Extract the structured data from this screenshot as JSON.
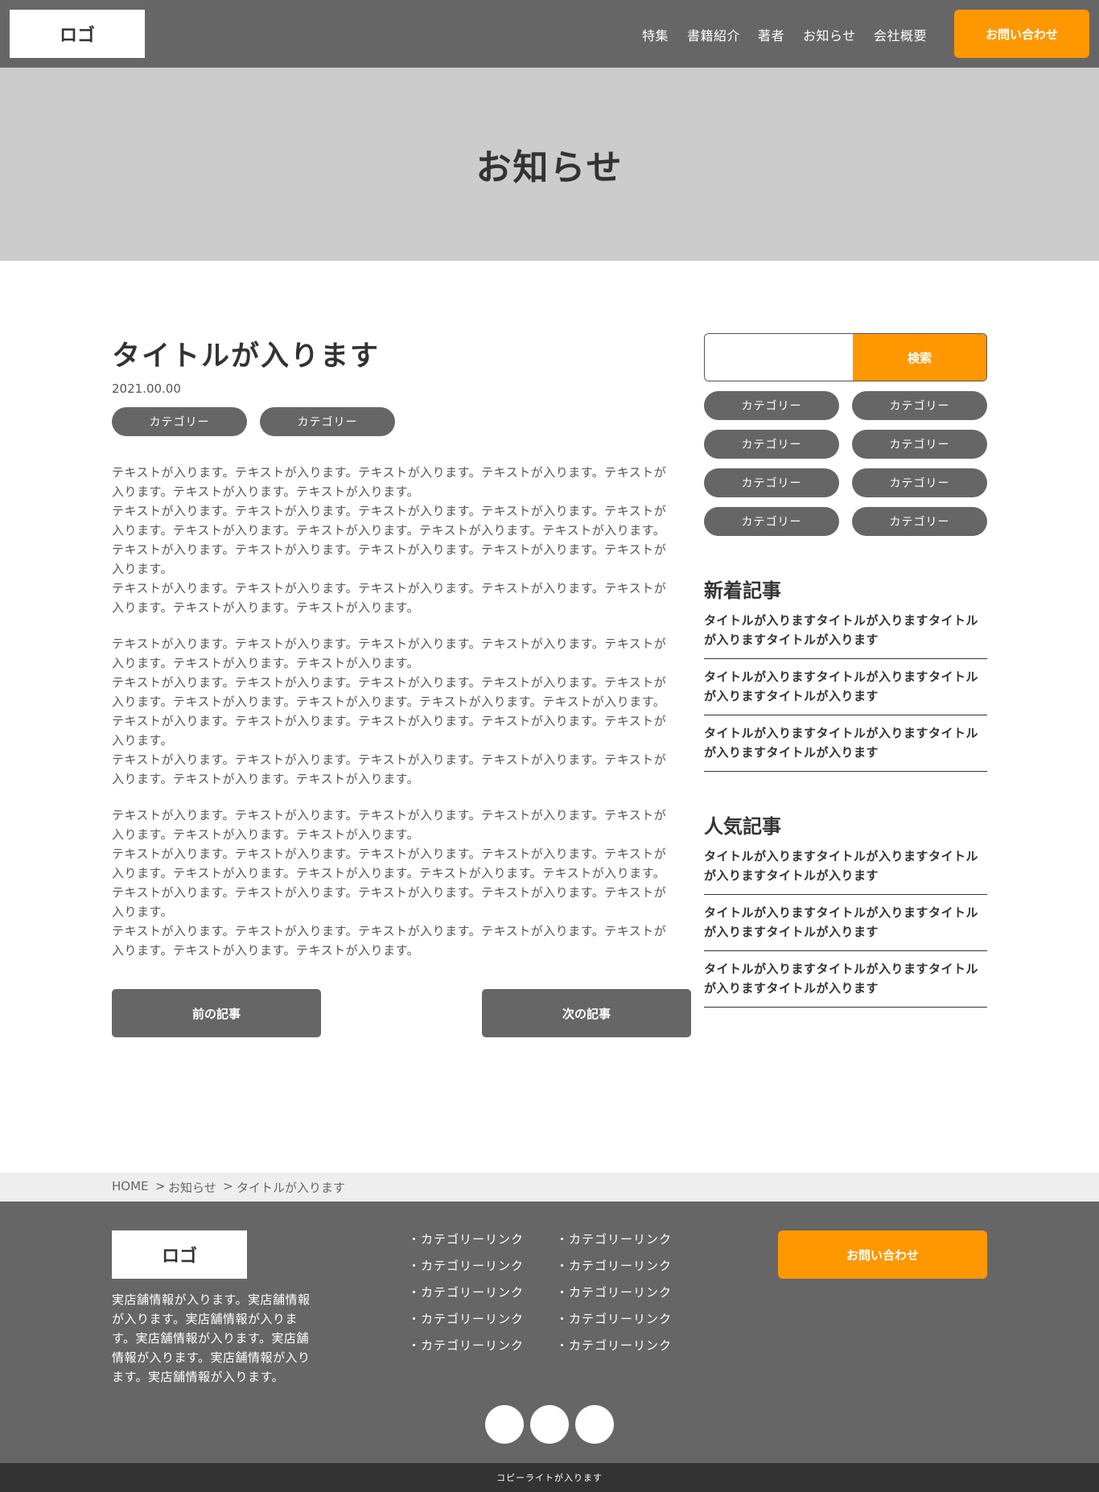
{
  "header": {
    "logo": "ロゴ",
    "nav": [
      "特集",
      "書籍紹介",
      "著者",
      "お知らせ",
      "会社概要"
    ],
    "contact_button": "お問い合わせ"
  },
  "hero": {
    "title": "お知らせ"
  },
  "article": {
    "title": "タイトルが入ります",
    "date": "2021.00.00",
    "categories": [
      "カテゴリー",
      "カテゴリー"
    ],
    "paragraph_lines": [
      "テキストが入ります。テキストが入ります。テキストが入ります。テキストが入ります。テキストが",
      "入ります。テキストが入ります。テキストが入ります。",
      "テキストが入ります。テキストが入ります。テキストが入ります。テキストが入ります。テキストが",
      "入ります。テキストが入ります。テキストが入ります。テキストが入ります。テキストが入ります。",
      "テキストが入ります。テキストが入ります。テキストが入ります。テキストが入ります。テキストが",
      "入ります。",
      "テキストが入ります。テキストが入ります。テキストが入ります。テキストが入ります。テキストが",
      "入ります。テキストが入ります。テキストが入ります。"
    ],
    "prev_button": "前の記事",
    "next_button": "次の記事"
  },
  "sidebar": {
    "search_button": "検索",
    "search_placeholder": "",
    "categories": [
      "カテゴリー",
      "カテゴリー",
      "カテゴリー",
      "カテゴリー",
      "カテゴリー",
      "カテゴリー",
      "カテゴリー",
      "カテゴリー"
    ],
    "new_heading": "新着記事",
    "new_items": [
      [
        "タイトルが入りますタイトルが入りますタイトル",
        "が入りますタイトルが入ります"
      ],
      [
        "タイトルが入りますタイトルが入りますタイトル",
        "が入りますタイトルが入ります"
      ],
      [
        "タイトルが入りますタイトルが入りますタイトル",
        "が入りますタイトルが入ります"
      ]
    ],
    "popular_heading": "人気記事",
    "popular_items": [
      [
        "タイトルが入りますタイトルが入りますタイトル",
        "が入りますタイトルが入ります"
      ],
      [
        "タイトルが入りますタイトルが入りますタイトル",
        "が入りますタイトルが入ります"
      ],
      [
        "タイトルが入りますタイトルが入りますタイトル",
        "が入りますタイトルが入ります"
      ]
    ]
  },
  "breadcrumb": {
    "home": "HOME",
    "sep1": ">",
    "section": "お知らせ",
    "sep2": ">",
    "current": "タイトルが入ります"
  },
  "footer": {
    "logo": "ロゴ",
    "info_lines": [
      "実店舗情報が入ります。実店舗情報",
      "が入ります。実店舗情報が入りま",
      "す。実店舗情報が入ります。実店舗",
      "情報が入ります。実店舗情報が入り",
      "ます。実店舗情報が入ります。"
    ],
    "links_col1": [
      "・カテゴリーリンク",
      "・カテゴリーリンク",
      "・カテゴリーリンク",
      "・カテゴリーリンク",
      "・カテゴリーリンク"
    ],
    "links_col2": [
      "・カテゴリーリンク",
      "・カテゴリーリンク",
      "・カテゴリーリンク",
      "・カテゴリーリンク",
      "・カテゴリーリンク"
    ],
    "contact_button": "お問い合わせ",
    "social_icons": [
      "social-icon",
      "social-icon",
      "social-icon"
    ]
  },
  "copyright": "コピーライトが入ります",
  "colors": {
    "accent": "#ff9800",
    "dark": "#666666",
    "hero": "#cccccc"
  }
}
